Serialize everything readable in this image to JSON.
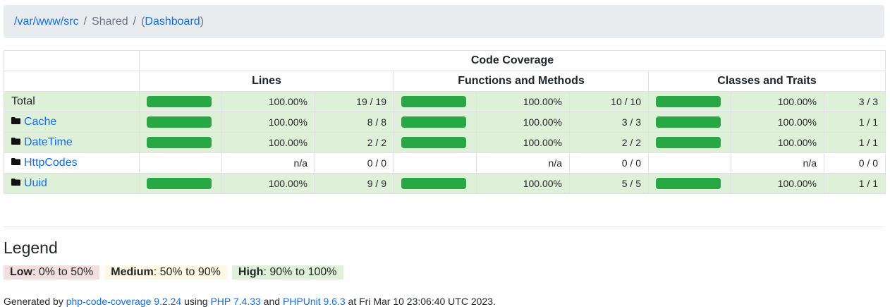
{
  "breadcrumb": {
    "root": "/var/www/src",
    "sep1": "/",
    "current": "Shared",
    "sep2": "/",
    "open_paren": "(",
    "dashboard": "Dashboard",
    "close_paren": ")"
  },
  "table": {
    "header_top": "Code Coverage",
    "header_lines": "Lines",
    "header_functions": "Functions and Methods",
    "header_classes": "Classes and Traits",
    "rows": [
      {
        "name": "Total",
        "is_link": false,
        "lines": {
          "bar": 1.0,
          "pct": "100.00%",
          "ratio": "19 / 19"
        },
        "functions": {
          "bar": 1.0,
          "pct": "100.00%",
          "ratio": "10 / 10"
        },
        "classes": {
          "bar": 1.0,
          "pct": "100.00%",
          "ratio": "3 / 3"
        }
      },
      {
        "name": "Cache",
        "is_link": true,
        "lines": {
          "bar": 1.0,
          "pct": "100.00%",
          "ratio": "8 / 8"
        },
        "functions": {
          "bar": 1.0,
          "pct": "100.00%",
          "ratio": "3 / 3"
        },
        "classes": {
          "bar": 1.0,
          "pct": "100.00%",
          "ratio": "1 / 1"
        }
      },
      {
        "name": "DateTime",
        "is_link": true,
        "lines": {
          "bar": 1.0,
          "pct": "100.00%",
          "ratio": "2 / 2"
        },
        "functions": {
          "bar": 1.0,
          "pct": "100.00%",
          "ratio": "2 / 2"
        },
        "classes": {
          "bar": 1.0,
          "pct": "100.00%",
          "ratio": "1 / 1"
        }
      },
      {
        "name": "HttpCodes",
        "is_link": true,
        "lines": {
          "bar": null,
          "pct": "n/a",
          "ratio": "0 / 0"
        },
        "functions": {
          "bar": null,
          "pct": "n/a",
          "ratio": "0 / 0"
        },
        "classes": {
          "bar": null,
          "pct": "n/a",
          "ratio": "0 / 0"
        }
      },
      {
        "name": "Uuid",
        "is_link": true,
        "lines": {
          "bar": 1.0,
          "pct": "100.00%",
          "ratio": "9 / 9"
        },
        "functions": {
          "bar": 1.0,
          "pct": "100.00%",
          "ratio": "5 / 5"
        },
        "classes": {
          "bar": 1.0,
          "pct": "100.00%",
          "ratio": "1 / 1"
        }
      }
    ]
  },
  "legend": {
    "title": "Legend",
    "low_label": "Low",
    "low_range": ": 0% to 50%",
    "medium_label": "Medium",
    "medium_range": ": 50% to 90%",
    "high_label": "High",
    "high_range": ": 90% to 100%"
  },
  "footer": {
    "generated_by": "Generated by ",
    "tool": "php-code-coverage 9.2.24",
    "using": " using ",
    "php": "PHP 7.4.33",
    "and": " and ",
    "phpunit": "PHPUnit 9.6.3",
    "at": " at Fri Mar 10 23:06:40 UTC 2023."
  },
  "colors": {
    "bar_success": "#28a745",
    "row_high": "#dff0d8",
    "legend_low": "#f2dede",
    "legend_medium": "#fcf8e3",
    "link": "#0d6efd"
  }
}
